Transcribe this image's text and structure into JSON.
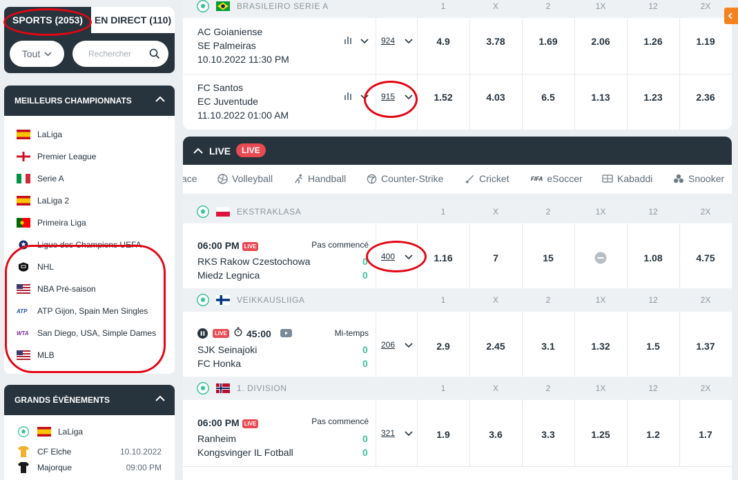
{
  "sidebar": {
    "tabs": {
      "sports": "SPORTS (2053)",
      "live": "EN DIRECT (110)"
    },
    "filter": {
      "select_value": "Tout",
      "search_placeholder": "Rechercher"
    },
    "top_champ": {
      "title": "MEILLEURS CHAMPIONNATS",
      "items": [
        {
          "label": "LaLiga",
          "icon": "spain-flag"
        },
        {
          "label": "Premier League",
          "icon": "england-flag"
        },
        {
          "label": "Serie A",
          "icon": "italy-flag"
        },
        {
          "label": "LaLiga 2",
          "icon": "spain-flag"
        },
        {
          "label": "Primeira Liga",
          "icon": "portugal-flag"
        },
        {
          "label": "Ligue des Champions UEFA",
          "icon": "champions-league-icon"
        },
        {
          "label": "NHL",
          "icon": "nhl-icon"
        },
        {
          "label": "NBA Pré-saison",
          "icon": "usa-flag"
        },
        {
          "label": "ATP Gijon, Spain Men Singles",
          "icon": "atp-icon"
        },
        {
          "label": "San Diego, USA, Simple Dames",
          "icon": "wta-icon"
        },
        {
          "label": "MLB",
          "icon": "usa-flag"
        }
      ]
    },
    "events": {
      "title": "GRANDS ÉVÈNEMENTS",
      "league": "LaLiga",
      "teams": [
        {
          "name": "CF Elche",
          "date": "10.10.2022",
          "jersey": "#f2b12c"
        },
        {
          "name": "Majorque",
          "date": "09:00 PM",
          "jersey": "#1a1a1a"
        }
      ]
    }
  },
  "prematch": {
    "league": "BRASILEIRO SERIE A",
    "columns": [
      "1",
      "X",
      "2",
      "1X",
      "12",
      "2X"
    ],
    "matches": [
      {
        "home": "AC Goianiense",
        "away": "SE Palmeiras",
        "datetime": "10.10.2022 11:30 PM",
        "count": "924",
        "odds": [
          "4.9",
          "3.78",
          "1.69",
          "2.06",
          "1.26",
          "1.19"
        ]
      },
      {
        "home": "FC Santos",
        "away": "EC Juventude",
        "datetime": "11.10.2022 01:00 AM",
        "count": "915",
        "odds": [
          "1.52",
          "4.03",
          "6.5",
          "1.13",
          "1.23",
          "2.36"
        ]
      }
    ]
  },
  "live": {
    "title": "LIVE",
    "badge": "LIVE",
    "sports": [
      "ace",
      "Volleyball",
      "Handball",
      "Counter-Strike",
      "Cricket",
      "eSoccer",
      "Kabaddi",
      "Snooker"
    ],
    "sports_fifa_prefix": "FIFA",
    "leagues": [
      {
        "name": "EKSTRAKLASA",
        "flag": "poland-flag",
        "columns": [
          "1",
          "X",
          "2",
          "1X",
          "12",
          "2X"
        ],
        "match": {
          "time": "06:00 PM",
          "live": "LIVE",
          "status": "Pas commencé",
          "home": "RKS Rakow Czestochowa",
          "away": "Miedz Legnica",
          "home_score": "0",
          "away_score": "0",
          "count": "400",
          "odds": [
            "1.16",
            "7",
            "15",
            "",
            "1.08",
            "4.75"
          ]
        }
      },
      {
        "name": "VEIKKAUSLIIGA",
        "flag": "finland-flag",
        "columns": [
          "1",
          "X",
          "2",
          "1X",
          "12",
          "2X"
        ],
        "match": {
          "time": "45:00",
          "live": "LIVE",
          "status": "Mi-temps",
          "home": "SJK Seinajoki",
          "away": "FC Honka",
          "home_score": "0",
          "away_score": "0",
          "count": "206",
          "odds": [
            "2.9",
            "2.45",
            "3.1",
            "1.32",
            "1.5",
            "1.37"
          ]
        }
      },
      {
        "name": "1. DIVISION",
        "flag": "norway-flag",
        "columns": [
          "1",
          "X",
          "2",
          "1X",
          "12",
          "2X"
        ],
        "match": {
          "time": "06:00 PM",
          "live": "LIVE",
          "status": "Pas commencé",
          "home": "Ranheim",
          "away": "Kongsvinger IL Fotball",
          "home_score": "0",
          "away_score": "0",
          "count": "321",
          "odds": [
            "1.9",
            "3.6",
            "3.3",
            "1.25",
            "1.2",
            "1.7"
          ]
        }
      }
    ]
  },
  "colors": {
    "dark": "#27343e",
    "accent": "#3cc19b",
    "live_red": "#e84a52",
    "annotation": "#e30613",
    "side_button": "#f58220"
  }
}
